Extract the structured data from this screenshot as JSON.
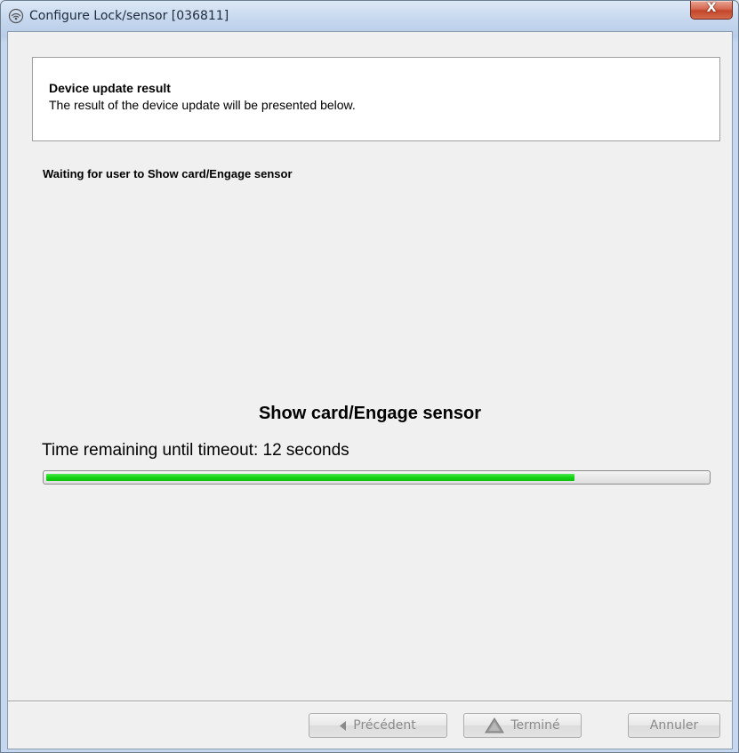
{
  "window": {
    "title": "Configure Lock/sensor [036811]",
    "close_glyph": "X"
  },
  "header": {
    "title": "Device update result",
    "description": "The result of the device update will be presented below."
  },
  "status": {
    "message": "Waiting for user to Show card/Engage sensor"
  },
  "prompt": {
    "heading": "Show card/Engage sensor",
    "timeout_text": "Time remaining until timeout: 12 seconds",
    "progress_fraction": 0.8,
    "progress_color": "#14d414"
  },
  "footer": {
    "previous_label": "Précédent",
    "previous_icon": "left-triangle-icon",
    "finish_label": "Terminé",
    "finish_icon": "warning-triangle-icon",
    "cancel_label": "Annuler"
  }
}
